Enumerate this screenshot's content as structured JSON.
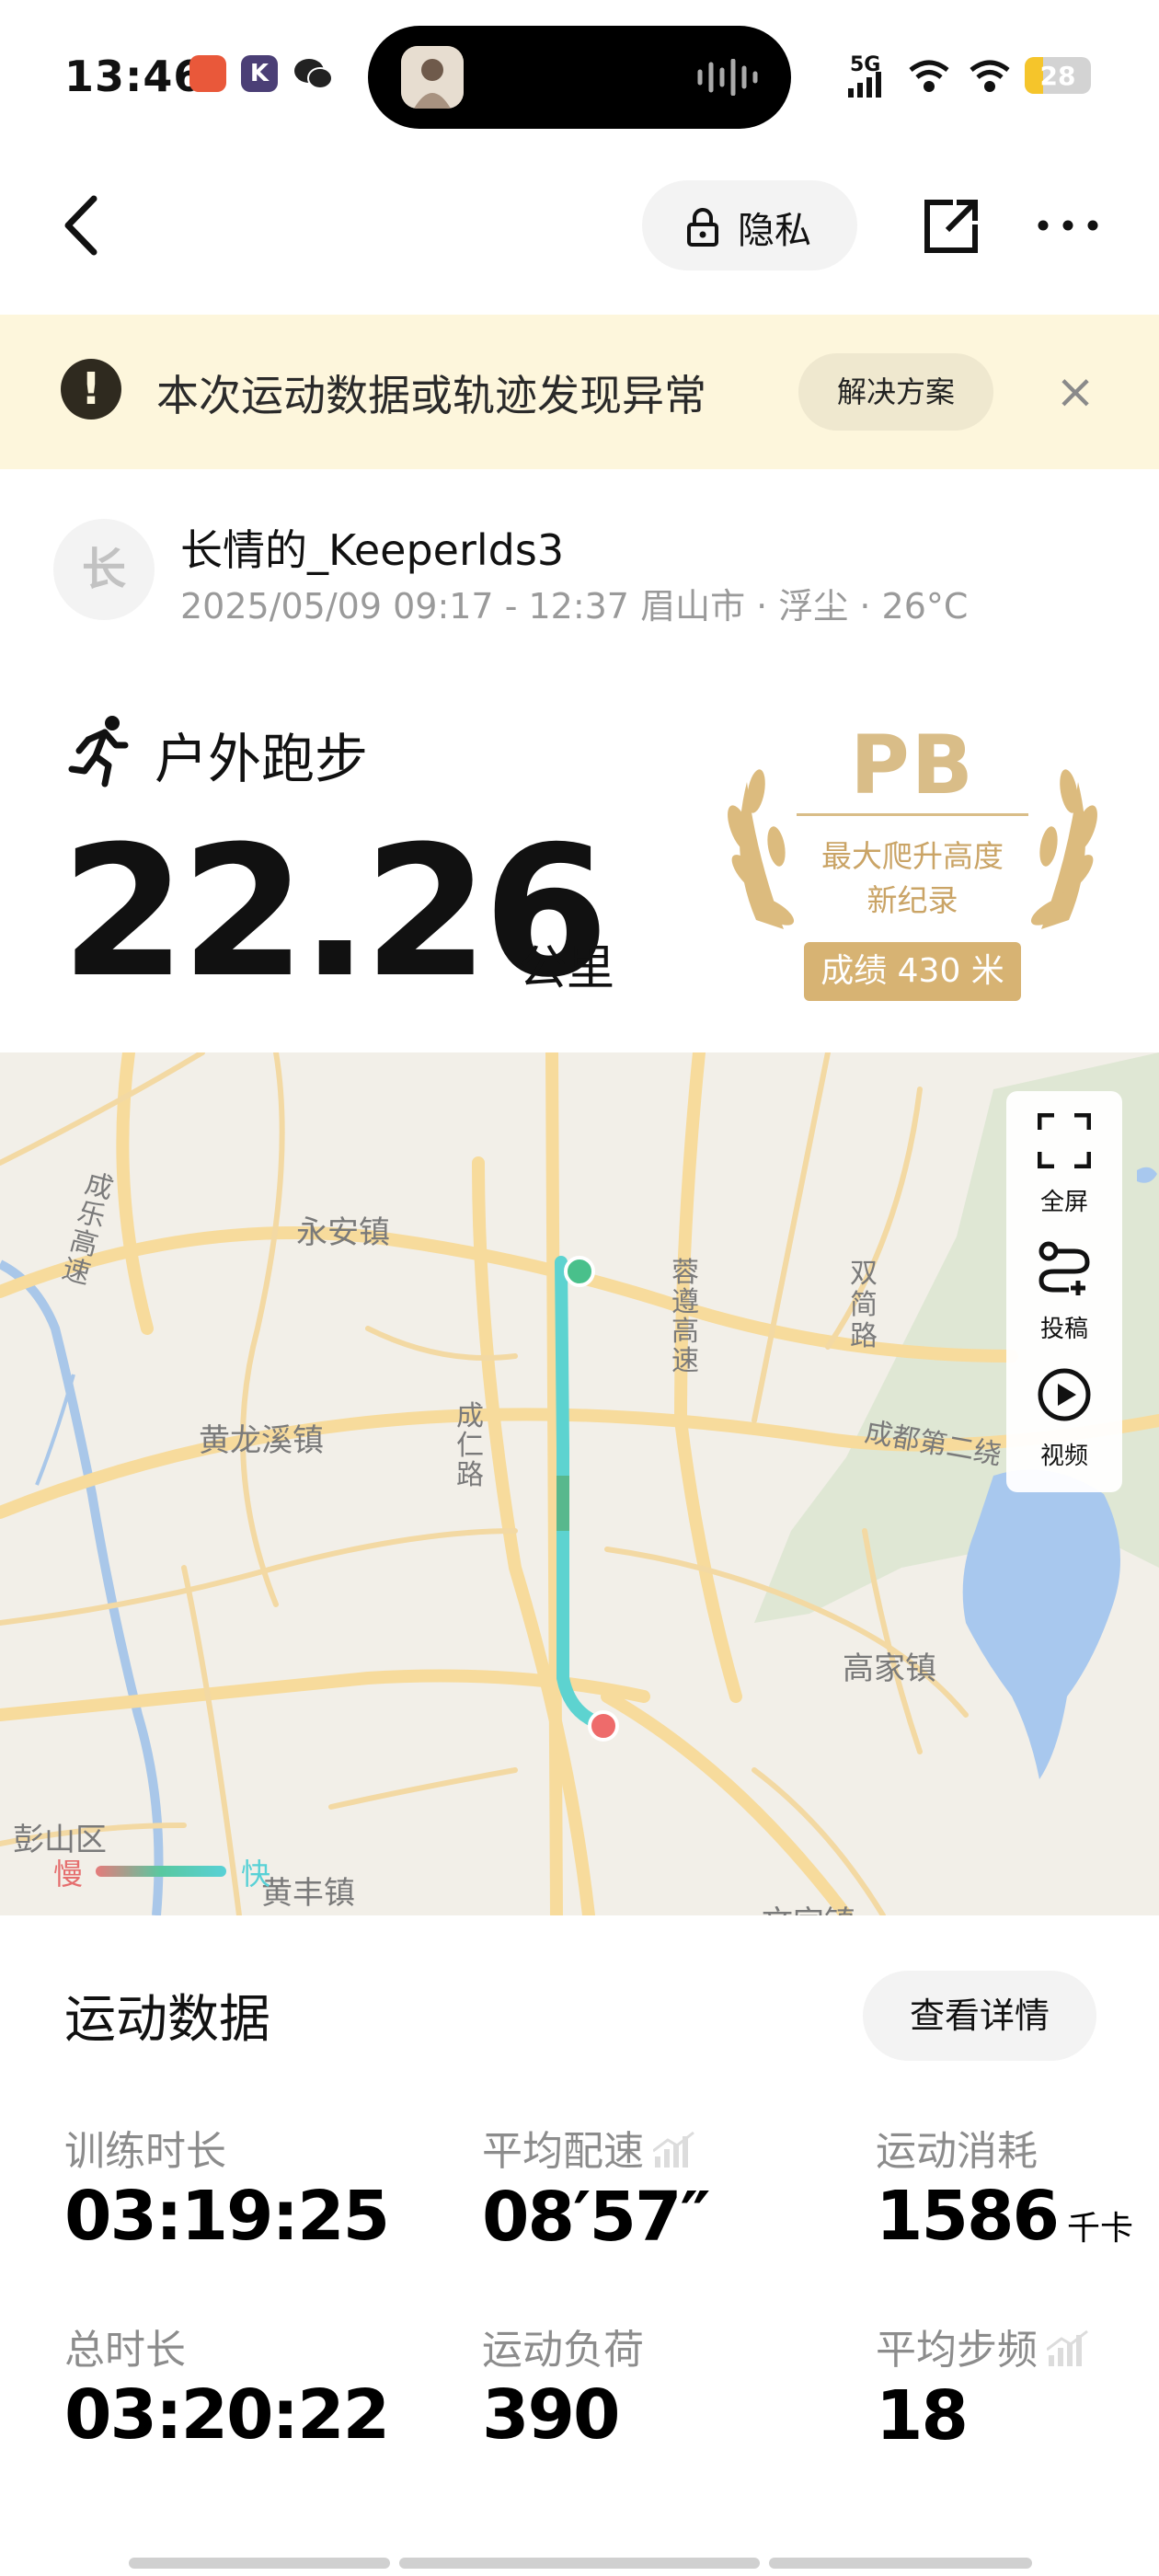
{
  "status_bar": {
    "time": "13:46",
    "network": "5G",
    "battery": "28",
    "battery_level": 0.28
  },
  "nav": {
    "privacy_label": "隐私"
  },
  "alert": {
    "icon": "!",
    "message": "本次运动数据或轨迹发现异常",
    "solution_label": "解决方案",
    "close": "×"
  },
  "user": {
    "avatar_char": "长",
    "name": "长情的_Keeperlds3",
    "meta": "2025/05/09 09:17 - 12:37 眉山市 · 浮尘 · 26°C"
  },
  "activity": {
    "type": "户外跑步",
    "distance": "22.26",
    "distance_unit": "公里"
  },
  "pb_badge": {
    "title": "PB",
    "line1": "最大爬升高度",
    "line2": "新纪录",
    "result": "成绩 430 米"
  },
  "map": {
    "tools": [
      {
        "label": "全屏",
        "icon": "fullscreen-icon"
      },
      {
        "label": "投稿",
        "icon": "route-icon"
      },
      {
        "label": "视频",
        "icon": "play-icon"
      }
    ],
    "labels": {
      "yongan": "永安镇",
      "chengle": "成乐高速",
      "huanglongxi": "黄龙溪镇",
      "chengren": "成仁路",
      "chunrong": "蓉遵高速",
      "shuangjian": "双简路",
      "chengdu_ring2": "成都第二绕",
      "gaojia": "高家镇",
      "pengshan": "彭山区",
      "huangfeng": "黄丰镇",
      "wengong": "文宫镇"
    },
    "legend_slow": "慢",
    "legend_fast": "快",
    "colors": {
      "route": "#5dd3d0",
      "start": "#49c08b",
      "end": "#ee6b6b"
    }
  },
  "stats": {
    "title": "运动数据",
    "details_label": "查看详情",
    "items": [
      {
        "label": "训练时长",
        "value": "03:19:25",
        "unit": ""
      },
      {
        "label": "平均配速",
        "value": "08′57″",
        "unit": ""
      },
      {
        "label": "运动消耗",
        "value": "1586",
        "unit": "千卡"
      },
      {
        "label": "总时长",
        "value": "03:20:22",
        "unit": ""
      },
      {
        "label": "运动负荷",
        "value": "390",
        "unit": ""
      },
      {
        "label": "平均步频",
        "value": "18",
        "unit": ""
      }
    ]
  }
}
